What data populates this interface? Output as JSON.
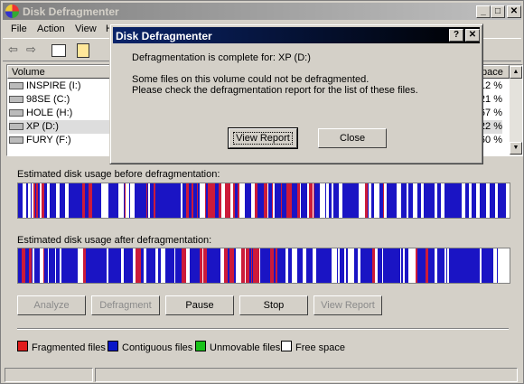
{
  "window": {
    "title": "Disk Defragmenter",
    "controls": {
      "minimize": "_",
      "maximize": "□",
      "close": "✕"
    }
  },
  "menu": [
    "File",
    "Action",
    "View",
    "H"
  ],
  "toolbar": {
    "back": "⇦",
    "forward": "⇨"
  },
  "volumes": {
    "headers": {
      "volume": "Volume",
      "free_pct": "pace"
    },
    "rows": [
      {
        "name": "INSPIRE (I:)",
        "pct": "12 %"
      },
      {
        "name": "98SE (C:)",
        "pct": "21 %"
      },
      {
        "name": "HOLE (H:)",
        "pct": "67 %"
      },
      {
        "name": "XP (D:)",
        "pct": "22 %"
      },
      {
        "name": "FURY (F:)",
        "pct": "60 %"
      }
    ]
  },
  "labels": {
    "before": "Estimated disk usage before defragmentation:",
    "after": "Estimated disk usage after defragmentation:"
  },
  "buttons": {
    "analyze": "Analyze",
    "defragment": "Defragment",
    "pause": "Pause",
    "stop": "Stop",
    "view_report": "View Report"
  },
  "legend": [
    {
      "label": "Fragmented files",
      "color": "#e01b1b"
    },
    {
      "label": "Contiguous files",
      "color": "#0a17c8"
    },
    {
      "label": "Unmovable files",
      "color": "#19c219"
    },
    {
      "label": "Free space",
      "color": "#ffffff"
    }
  ],
  "colors": {
    "fragmented": "#cc1b3a",
    "contiguous": "#1a14c4",
    "free": "#ffffff"
  },
  "dialog": {
    "title": "Disk Defragmenter",
    "controls": {
      "help": "?",
      "close": "✕"
    },
    "line1": "Defragmentation is complete for: XP (D:)",
    "line2": "Some files on this volume could not be defragmented.",
    "line3": "Please check the defragmentation report for the list of these files.",
    "view_report": "View Report",
    "close": "Close"
  }
}
